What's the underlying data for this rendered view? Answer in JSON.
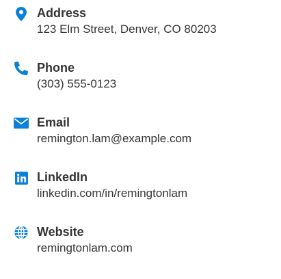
{
  "accent_color": "#0a80d8",
  "contacts": [
    {
      "icon": "map-pin-icon",
      "label": "Address",
      "value": "123 Elm Street, Denver, CO 80203"
    },
    {
      "icon": "phone-icon",
      "label": "Phone",
      "value": "(303) 555-0123"
    },
    {
      "icon": "envelope-icon",
      "label": "Email",
      "value": "remington.lam@example.com"
    },
    {
      "icon": "linkedin-icon",
      "label": "LinkedIn",
      "value": "linkedin.com/in/remingtonlam"
    },
    {
      "icon": "globe-icon",
      "label": "Website",
      "value": "remingtonlam.com"
    }
  ]
}
